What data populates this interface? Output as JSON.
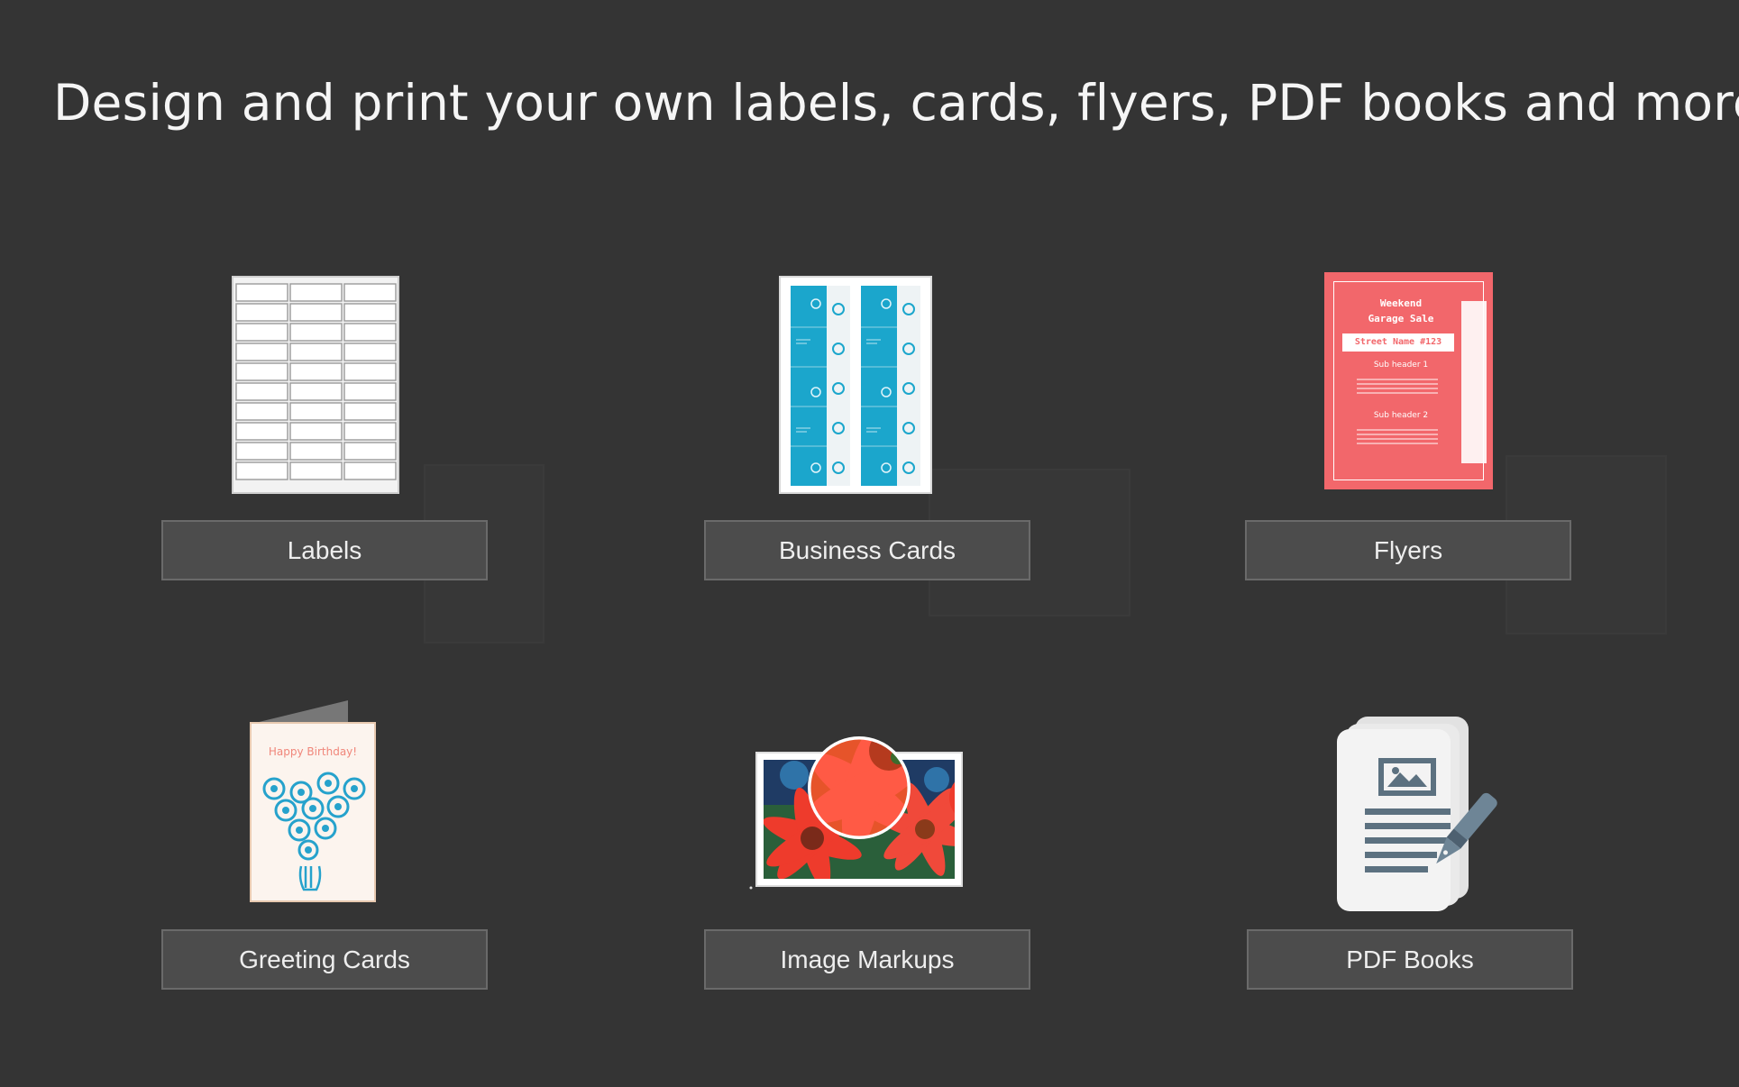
{
  "headline": "Design and print your own labels, cards, flyers, PDF books and more!",
  "tiles": [
    {
      "id": "labels",
      "label": "Labels",
      "icon": "label-sheet-icon"
    },
    {
      "id": "business-cards",
      "label": "Business Cards",
      "icon": "business-card-sheet-icon"
    },
    {
      "id": "flyers",
      "label": "Flyers",
      "icon": "flyer-icon"
    },
    {
      "id": "greeting-cards",
      "label": "Greeting Cards",
      "icon": "greeting-card-icon"
    },
    {
      "id": "image-markups",
      "label": "Image Markups",
      "icon": "magnified-photo-icon"
    },
    {
      "id": "pdf-books",
      "label": "PDF Books",
      "icon": "document-pen-icon"
    }
  ],
  "flyer": {
    "title_line1": "Weekend",
    "title_line2": "Garage Sale",
    "street": "Street Name #123",
    "sub1": "Sub header 1",
    "sub2": "Sub header 2"
  },
  "greeting": {
    "text": "Happy Birthday!"
  },
  "colors": {
    "background": "#343434",
    "button": "#4c4c4c",
    "business_card_blue": "#1ba6cc",
    "flyer_red": "#f2676b",
    "flower_red": "#ee3b2c"
  }
}
